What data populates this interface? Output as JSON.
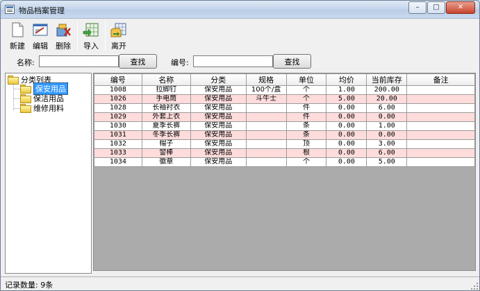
{
  "window": {
    "title": "物品档案管理",
    "controls": {
      "minimize": "–",
      "maximize": "□",
      "close": "✕"
    }
  },
  "toolbar": {
    "new_label": "新建",
    "edit_label": "编辑",
    "delete_label": "删除",
    "import_label": "导入",
    "exit_label": "离开"
  },
  "search": {
    "name_label": "名称:",
    "name_value": "",
    "name_button": "查找",
    "code_label": "编号:",
    "code_value": "",
    "code_button": "查找"
  },
  "tree": {
    "root": "分类列表",
    "children": [
      "保安用品",
      "保洁用品",
      "维修用料"
    ],
    "selected": "保安用品"
  },
  "grid": {
    "columns": [
      "编号",
      "名称",
      "分类",
      "规格",
      "单位",
      "均价",
      "当前库存",
      "备注"
    ],
    "rows": [
      [
        "1008",
        "拉脚钉",
        "保安用品",
        "100个/盒",
        "个",
        "1.00",
        "200.00",
        ""
      ],
      [
        "1026",
        "手电筒",
        "保安用品",
        "斗牛士",
        "个",
        "5.00",
        "20.00",
        ""
      ],
      [
        "1028",
        "长袖衬衣",
        "保安用品",
        "",
        "件",
        "0.00",
        "6.00",
        ""
      ],
      [
        "1029",
        "外套上衣",
        "保安用品",
        "",
        "件",
        "0.00",
        "0.00",
        ""
      ],
      [
        "1030",
        "夏季长裤",
        "保安用品",
        "",
        "条",
        "0.00",
        "1.00",
        ""
      ],
      [
        "1031",
        "冬季长裤",
        "保安用品",
        "",
        "条",
        "0.00",
        "0.00",
        ""
      ],
      [
        "1032",
        "帽子",
        "保安用品",
        "",
        "顶",
        "0.00",
        "3.00",
        ""
      ],
      [
        "1033",
        "警棒",
        "保安用品",
        "",
        "根",
        "0.00",
        "6.00",
        ""
      ],
      [
        "1034",
        "徽章",
        "保安用品",
        "",
        "个",
        "0.00",
        "5.00",
        ""
      ]
    ]
  },
  "status": {
    "record_count": "记录数量: 9条"
  },
  "colors": {
    "row_alt": "#ffdcdc",
    "grid_empty": "#ababab",
    "selection": "#3399ff"
  }
}
